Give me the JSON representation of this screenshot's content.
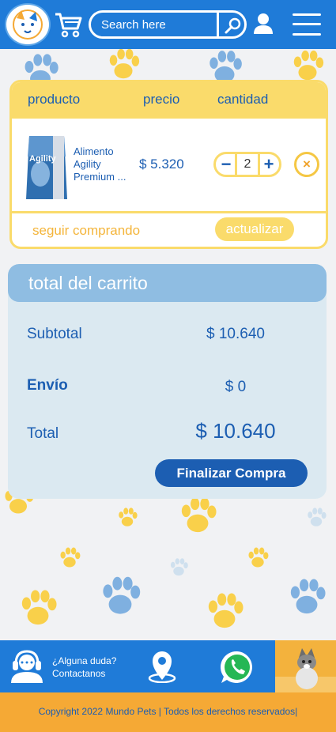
{
  "header": {
    "search_placeholder": "Search here"
  },
  "cart": {
    "columns": [
      "producto",
      "precio",
      "cantidad"
    ],
    "items": [
      {
        "name": "Alimento Agility Premium ...",
        "price": "$ 5.320",
        "quantity": "2",
        "brand_label": "Agility"
      }
    ],
    "continue_label": "seguir comprando",
    "update_label": "actualizar",
    "qty_minus": "−",
    "qty_plus": "+",
    "remove_symbol": "×"
  },
  "totals": {
    "title": "total del carrito",
    "subtotal_label": "Subtotal",
    "subtotal_value": "$ 10.640",
    "shipping_label": "Envío",
    "shipping_value": "$ 0",
    "total_label": "Total",
    "total_value": "$ 10.640",
    "checkout_label": "Finalizar Compra"
  },
  "footer": {
    "contact_line1": "¿Alguna duda?",
    "contact_line2": "Contactanos",
    "copyright": "Copyright 2022 Mundo Pets | Todos los derechos reservados|"
  },
  "colors": {
    "primary_blue": "#1f7bd8",
    "dark_blue": "#1c5eb2",
    "yellow": "#fadb6b",
    "orange": "#f5a935",
    "light_blue": "#8fbde2",
    "panel_bg": "#dbe9f1"
  }
}
